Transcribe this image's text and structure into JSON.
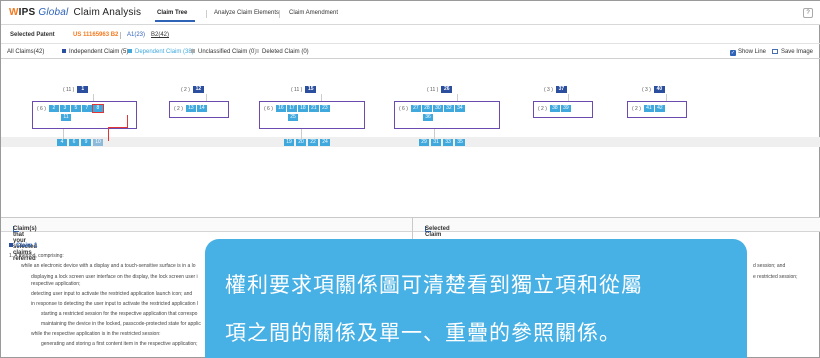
{
  "header": {
    "logo_w": "W",
    "logo_ips": "IPS",
    "logo_global": "Global",
    "logo_title": "Claim Analysis",
    "tabs": [
      {
        "label": "Claim Tree"
      },
      {
        "label": "Analyze Claim Elements"
      },
      {
        "label": "Claim Amendment"
      }
    ],
    "help": "?"
  },
  "patent": {
    "label": "Selected Patent",
    "number": "US 11165963 B2",
    "a1": "A1(23)",
    "b2": "B2(42)"
  },
  "filters": {
    "all": "All Claims(42)",
    "independent": "Independent Claim (5)",
    "dependent": "Dependent Claim (38)",
    "unclassified": "Unclassified Claim (0)",
    "deleted": "Deleted Claim (0)",
    "show_line": "Show Line",
    "save_image": "Save Image",
    "colors": {
      "independent": "#2b4f9e",
      "dependent": "#3fa9de",
      "unclassified": "#aaaaaa",
      "deleted": "#cccccc"
    }
  },
  "tree": {
    "groups": [
      {
        "root_paren": "( 11 )",
        "root": "1",
        "count": "( 6 )",
        "deps": [
          "2",
          "3",
          "5",
          "7",
          "8",
          "11"
        ],
        "subs": [
          "4",
          "6",
          "9",
          "10"
        ]
      },
      {
        "root_paren": "( 2 )",
        "root": "12",
        "count": "( 2 )",
        "deps": [
          "13",
          "14"
        ],
        "subs": []
      },
      {
        "root_paren": "( 11 )",
        "root": "15",
        "count": "( 6 )",
        "deps": [
          "16",
          "17",
          "18",
          "21",
          "23",
          "25"
        ],
        "subs": [
          "19",
          "20",
          "22",
          "24"
        ]
      },
      {
        "root_paren": "( 11 )",
        "root": "26",
        "count": "( 6 )",
        "deps": [
          "27",
          "28",
          "30",
          "32",
          "34",
          "36"
        ],
        "subs": [
          "29",
          "31",
          "33",
          "35"
        ]
      },
      {
        "root_paren": "( 3 )",
        "root": "37",
        "count": "( 2 )",
        "deps": [
          "38",
          "39"
        ],
        "subs": []
      },
      {
        "root_paren": "( 3 )",
        "root": "40",
        "count": "( 2 )",
        "deps": [
          "41",
          "42"
        ],
        "subs": []
      }
    ]
  },
  "panels": {
    "left_title": "Claim(s) that your selected claims referred",
    "right_title": "Selected Claim",
    "claim_heading": "Claim 1",
    "lines": [
      "1. A method, comprising:",
      "while an electronic device with a display and a touch-sensitive surface is in a lo",
      "displaying a lock screen user interface on the display, the lock screen user i",
      "respective application;",
      "detecting user input to activate the restricted application launch icon; and",
      "in response to detecting the user input to activate the restricted application l",
      "starting a restricted session for the respective application that correspo",
      "maintaining the device in the locked, passcode-protected state for applic",
      "while the respective application is in the restricted session:",
      "generating and storing a first content item in the respective application;"
    ],
    "right_fragments": [
      "d session; and",
      "e restricted session;"
    ]
  },
  "overlay": {
    "line1": "權利要求項關係圖可清楚看到獨立項和從屬",
    "line2": "項之間的關係及單一、重疊的參照關係。"
  }
}
